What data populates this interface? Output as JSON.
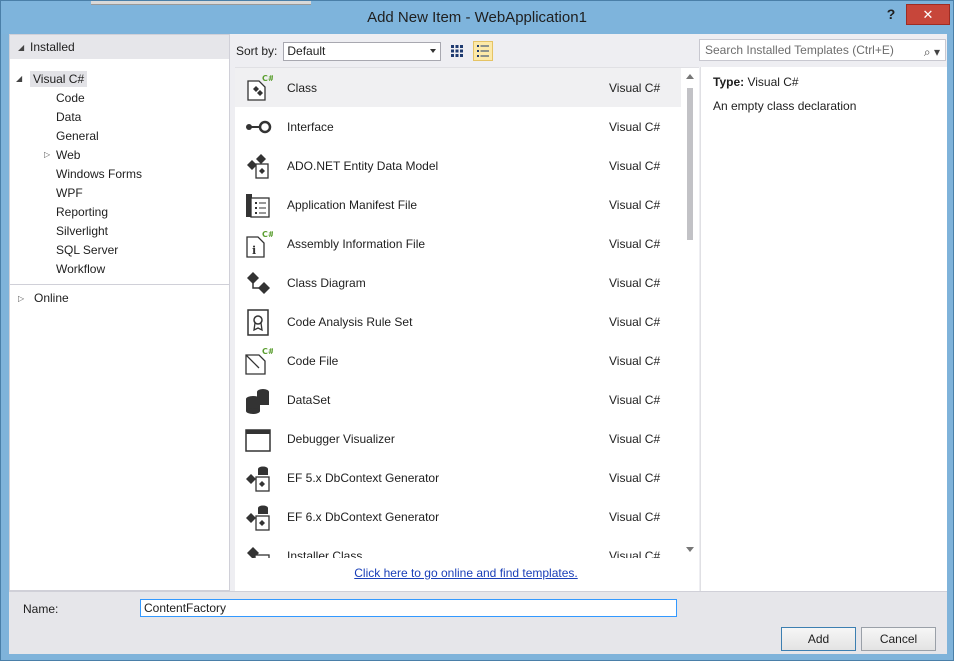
{
  "window": {
    "title": "Add New Item - WebApplication1",
    "help_glyph": "?",
    "close_glyph": "✕"
  },
  "left": {
    "installed_header": "Installed",
    "root_label": "Visual C#",
    "items": [
      "Code",
      "Data",
      "General",
      "Web",
      "Windows Forms",
      "WPF",
      "Reporting",
      "Silverlight",
      "SQL Server",
      "Workflow"
    ],
    "online_label": "Online"
  },
  "toolbar": {
    "sort_label": "Sort by:",
    "sort_value": "Default",
    "view_icons": [
      "grid-view-icon",
      "list-view-icon"
    ],
    "search_placeholder": "Search Installed Templates (Ctrl+E)"
  },
  "templates": [
    {
      "name": "Class",
      "lang": "Visual C#",
      "icon": "class-icon"
    },
    {
      "name": "Interface",
      "lang": "Visual C#",
      "icon": "interface-icon"
    },
    {
      "name": "ADO.NET Entity Data Model",
      "lang": "Visual C#",
      "icon": "entity-model-icon"
    },
    {
      "name": "Application Manifest File",
      "lang": "Visual C#",
      "icon": "manifest-icon"
    },
    {
      "name": "Assembly Information File",
      "lang": "Visual C#",
      "icon": "assembly-info-icon"
    },
    {
      "name": "Class Diagram",
      "lang": "Visual C#",
      "icon": "class-diagram-icon"
    },
    {
      "name": "Code Analysis Rule Set",
      "lang": "Visual C#",
      "icon": "rule-set-icon"
    },
    {
      "name": "Code File",
      "lang": "Visual C#",
      "icon": "code-file-icon"
    },
    {
      "name": "DataSet",
      "lang": "Visual C#",
      "icon": "dataset-icon"
    },
    {
      "name": "Debugger Visualizer",
      "lang": "Visual C#",
      "icon": "debugger-visualizer-icon"
    },
    {
      "name": "EF 5.x DbContext Generator",
      "lang": "Visual C#",
      "icon": "ef-generator-icon"
    },
    {
      "name": "EF 6.x DbContext Generator",
      "lang": "Visual C#",
      "icon": "ef-generator-icon"
    },
    {
      "name": "Installer Class",
      "lang": "Visual C#",
      "icon": "installer-class-icon"
    }
  ],
  "online_link": "Click here to go online and find templates.",
  "details": {
    "type_label": "Type:",
    "type_value": "Visual C#",
    "description": "An empty class declaration"
  },
  "bottom": {
    "name_label": "Name:",
    "name_value": "ContentFactory",
    "add_label": "Add",
    "cancel_label": "Cancel"
  },
  "colors": {
    "title_bar": "#7eb4dc",
    "close_button": "#c7463a",
    "link": "#1a3fb8",
    "csharp_badge": "#5a9e2f"
  }
}
